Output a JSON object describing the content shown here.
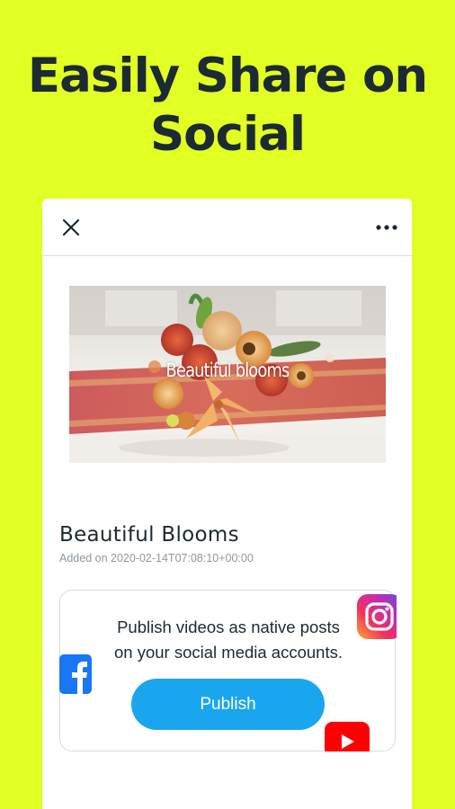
{
  "headline": {
    "line1": "Easily Share on",
    "line2": "Social"
  },
  "toolbar": {
    "close_icon": "close-icon",
    "more_icon": "more-horizontal-icon"
  },
  "video": {
    "overlay_text": "Beautiful blooms"
  },
  "item": {
    "title": "Beautiful Blooms",
    "added": "Added on 2020-02-14T07:08:10+00:00"
  },
  "publish": {
    "line1": "Publish videos as native posts",
    "line2": "on your social media accounts.",
    "button_label": "Publish"
  },
  "social_icons": [
    "instagram-icon",
    "facebook-icon",
    "youtube-icon"
  ],
  "colors": {
    "background": "#e2ff24",
    "text_dark": "#1c2a33",
    "button": "#1aa6ee",
    "facebook": "#1877f2",
    "youtube": "#ff0000"
  }
}
